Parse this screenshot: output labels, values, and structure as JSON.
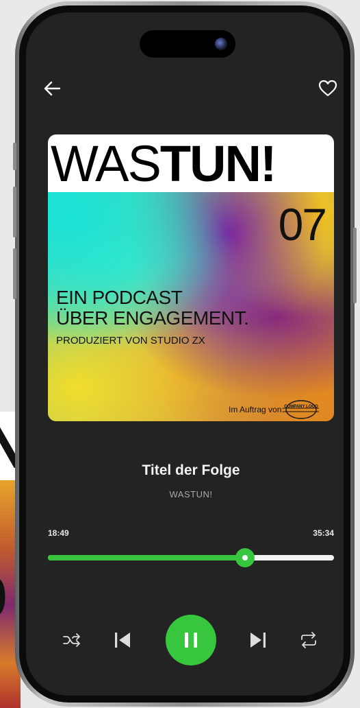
{
  "background": {
    "partial_letter": "N",
    "partial_number": "0"
  },
  "nav": {
    "back_icon": "arrow-left-icon",
    "favorite_icon": "heart-outline-icon"
  },
  "cover": {
    "title_light": "WAS",
    "title_bold": "TUN!",
    "episode_number": "07",
    "line1": "EIN PODCAST",
    "line2": "ÜBER ENGAGEMENT.",
    "producer": "PRODUZIERT VON STUDIO ZX",
    "commission_label": "Im Auftrag von:",
    "company_logo": "COMPANY LOGO"
  },
  "track": {
    "title": "Titel der Folge",
    "artist": "WASTUN!"
  },
  "progress": {
    "elapsed": "18:49",
    "total": "35:34",
    "fraction": 0.69
  },
  "controls": {
    "shuffle_icon": "shuffle-icon",
    "previous_icon": "skip-previous-icon",
    "play_pause_icon": "pause-icon",
    "next_icon": "skip-next-icon",
    "repeat_icon": "repeat-icon"
  },
  "colors": {
    "accent": "#39c63f",
    "screen_bg": "#232323",
    "text_primary": "#f4f4f4",
    "text_secondary": "#a9a9a9"
  }
}
